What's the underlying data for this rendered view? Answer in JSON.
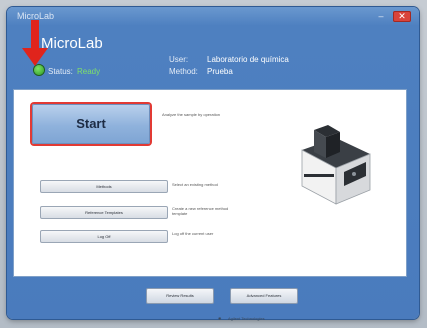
{
  "window": {
    "title": "MicroLab",
    "minimize": "–",
    "close": "✕"
  },
  "header": {
    "app_title": "MicroLab",
    "user_label": "User:",
    "user_value": "Laboratorio de química",
    "status_label": "Status:",
    "status_value": "Ready",
    "method_label": "Method:",
    "method_value": "Prueba"
  },
  "main": {
    "start_label": "Start",
    "start_desc": "Analyze the sample by operation",
    "buttons": [
      {
        "label": "Methods",
        "desc": "Select an existing method"
      },
      {
        "label": "Reference Templates",
        "desc": "Create a new reference method template"
      },
      {
        "label": "Log Off",
        "desc": "Log off the current user"
      }
    ]
  },
  "bottom": {
    "review_results": "Review Results",
    "advanced_features": "Advanced Features"
  },
  "footer": {
    "brand": "Agilent Technologies"
  },
  "colors": {
    "status_ready": "#3cb82a",
    "highlight": "#e23a34",
    "accent": "#4a7bbd"
  }
}
